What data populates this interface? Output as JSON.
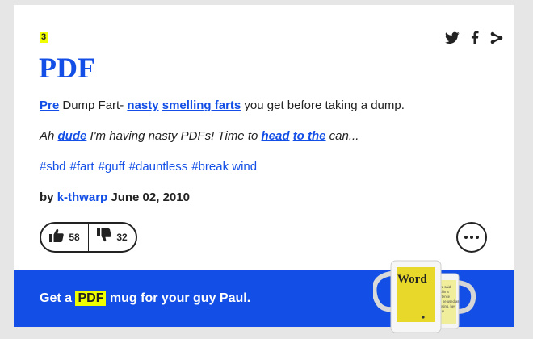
{
  "entry": {
    "rank": "3",
    "word": "PDF",
    "meaning": [
      {
        "text": "Pre",
        "link": true
      },
      {
        "text": " Dump Fart- ",
        "link": false
      },
      {
        "text": "nasty",
        "link": true
      },
      {
        "text": " ",
        "link": false
      },
      {
        "text": "smelling farts",
        "link": true
      },
      {
        "text": " you get before taking a dump.",
        "link": false
      }
    ],
    "example": [
      {
        "text": "Ah ",
        "link": false
      },
      {
        "text": "dude",
        "link": true
      },
      {
        "text": " I'm having nasty PDFs! Time to ",
        "link": false
      },
      {
        "text": "head",
        "link": true
      },
      {
        "text": " ",
        "link": false
      },
      {
        "text": "to the",
        "link": true
      },
      {
        "text": " can...",
        "link": false
      }
    ],
    "tags": [
      "#sbd",
      "#fart",
      "#guff",
      "#dauntless",
      "#break wind"
    ],
    "by_label": "by",
    "author": "k-thwarp",
    "date": "June 02, 2010",
    "upvotes": "58",
    "downvotes": "32"
  },
  "share_icons": [
    "twitter-icon",
    "facebook-icon",
    "share-icon"
  ],
  "promo": {
    "prefix": "Get a",
    "highlight": "PDF",
    "suffix": "mug for your guy Paul.",
    "mug_word": "Word"
  },
  "colors": {
    "brand_blue": "#134fe6",
    "highlight_yellow": "#efff00",
    "text_dark": "#222222"
  }
}
